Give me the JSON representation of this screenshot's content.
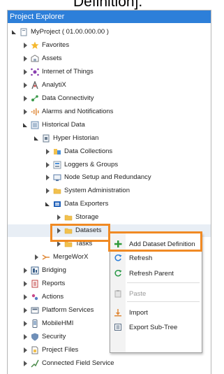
{
  "caption": "Definition].",
  "panel": {
    "title": "Project Explorer"
  },
  "tree": [
    {
      "label": "MyProject ( 01.00.000.00 )",
      "level": 0,
      "state": "expanded",
      "icon": "project-icon"
    },
    {
      "label": "Favorites",
      "level": 1,
      "state": "collapsed",
      "icon": "star-icon"
    },
    {
      "label": "Assets",
      "level": 1,
      "state": "collapsed",
      "icon": "assets-icon"
    },
    {
      "label": "Internet of Things",
      "level": 1,
      "state": "collapsed",
      "icon": "iot-icon"
    },
    {
      "label": "AnalytiX",
      "level": 1,
      "state": "collapsed",
      "icon": "analytix-icon"
    },
    {
      "label": "Data Connectivity",
      "level": 1,
      "state": "collapsed",
      "icon": "connectivity-icon"
    },
    {
      "label": "Alarms and Notifications",
      "level": 1,
      "state": "collapsed",
      "icon": "alarm-icon"
    },
    {
      "label": "Historical Data",
      "level": 1,
      "state": "expanded",
      "icon": "historical-data-icon"
    },
    {
      "label": "Hyper Historian",
      "level": 2,
      "state": "expanded",
      "icon": "historian-icon"
    },
    {
      "label": "Data Collections",
      "level": 3,
      "state": "collapsed",
      "icon": "data-collections-icon"
    },
    {
      "label": "Loggers & Groups",
      "level": 3,
      "state": "collapsed",
      "icon": "loggers-icon"
    },
    {
      "label": "Node Setup and Redundancy",
      "level": 3,
      "state": "collapsed",
      "icon": "node-setup-icon"
    },
    {
      "label": "System Administration",
      "level": 3,
      "state": "collapsed",
      "icon": "folder-icon"
    },
    {
      "label": "Data Exporters",
      "level": 3,
      "state": "expanded",
      "icon": "data-exporters-icon"
    },
    {
      "label": "Storage",
      "level": 4,
      "state": "collapsed",
      "icon": "folder-icon"
    },
    {
      "label": "Datasets",
      "level": 4,
      "state": "collapsed",
      "icon": "folder-icon"
    },
    {
      "label": "Tasks",
      "level": 4,
      "state": "collapsed",
      "icon": "folder-icon"
    },
    {
      "label": "MergeWorX",
      "level": 2,
      "state": "collapsed",
      "icon": "mergeworx-icon"
    },
    {
      "label": "Bridging",
      "level": 1,
      "state": "collapsed",
      "icon": "bridging-icon"
    },
    {
      "label": "Reports",
      "level": 1,
      "state": "collapsed",
      "icon": "reports-icon"
    },
    {
      "label": "Actions",
      "level": 1,
      "state": "collapsed",
      "icon": "actions-icon"
    },
    {
      "label": "Platform Services",
      "level": 1,
      "state": "collapsed",
      "icon": "platform-icon"
    },
    {
      "label": "MobileHMI",
      "level": 1,
      "state": "collapsed",
      "icon": "mobile-icon"
    },
    {
      "label": "Security",
      "level": 1,
      "state": "collapsed",
      "icon": "security-icon"
    },
    {
      "label": "Project Files",
      "level": 1,
      "state": "collapsed",
      "icon": "project-files-icon"
    },
    {
      "label": "Connected Field Service",
      "level": 1,
      "state": "collapsed",
      "icon": "field-service-icon"
    }
  ],
  "context_menu": {
    "items": [
      {
        "label": "Add Dataset Definition",
        "icon": "add-icon",
        "disabled": false
      },
      {
        "label": "Refresh",
        "icon": "refresh-icon",
        "disabled": false
      },
      {
        "label": "Refresh Parent",
        "icon": "refresh-parent-icon",
        "disabled": false
      },
      {
        "label": "Paste",
        "icon": "paste-icon",
        "disabled": true
      },
      {
        "label": "Import",
        "icon": "import-icon",
        "disabled": false
      },
      {
        "label": "Export Sub-Tree",
        "icon": "export-icon",
        "disabled": false
      }
    ]
  },
  "colors": {
    "accent": "#2d7fd9",
    "highlight": "#f08a24",
    "folder": "#f2c14e"
  }
}
